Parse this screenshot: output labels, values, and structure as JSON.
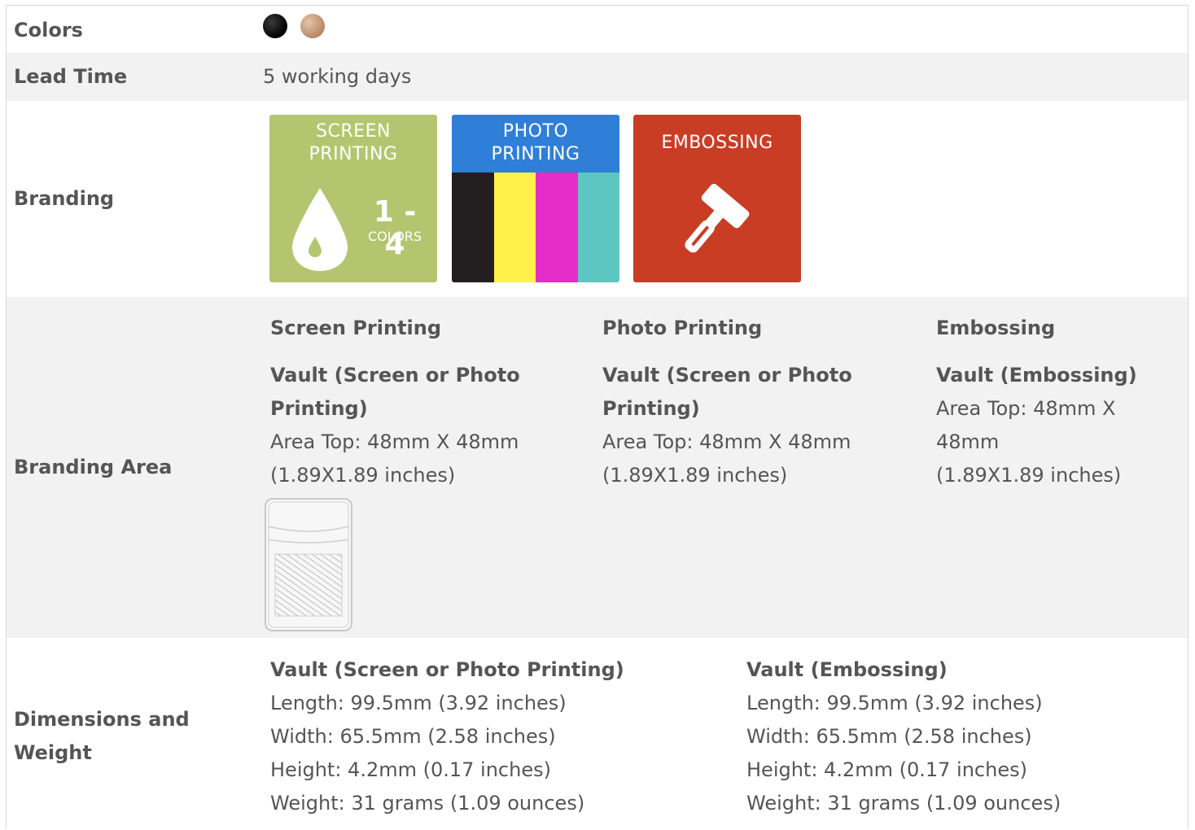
{
  "rows": {
    "colors": {
      "label": "Colors",
      "swatches": [
        "#111111",
        "#c9a07e"
      ]
    },
    "lead_time": {
      "label": "Lead Time",
      "value": "5 working days"
    },
    "branding": {
      "label": "Branding",
      "tiles": {
        "screen": {
          "title_line1": "SCREEN",
          "title_line2": "PRINTING",
          "count": "1 - 4",
          "count_unit": "COLORS",
          "color": "#b5c56f"
        },
        "photo": {
          "title_line1": "PHOTO",
          "title_line2": "PRINTING",
          "header_color": "#2f7fd8",
          "stripes": [
            "#231f20",
            "#fff04a",
            "#e52dc7",
            "#5ec6c0"
          ]
        },
        "emboss": {
          "title": "EMBOSSING",
          "color": "#c93d24"
        }
      }
    },
    "branding_area": {
      "label": "Branding Area",
      "columns": [
        {
          "heading": "Screen Printing",
          "sub1": "Vault (Screen or Photo",
          "sub2": "Printing)",
          "line1": "Area Top: 48mm X 48mm",
          "line2": "(1.89X1.89 inches)"
        },
        {
          "heading": "Photo Printing",
          "sub1": "Vault (Screen or Photo",
          "sub2": "Printing)",
          "line1": "Area Top: 48mm X 48mm",
          "line2": "(1.89X1.89 inches)"
        },
        {
          "heading": "Embossing",
          "sub1": "Vault (Embossing)",
          "line1": "Area Top: 48mm X",
          "line2": "48mm",
          "line3": "(1.89X1.89 inches)"
        }
      ]
    },
    "dimensions": {
      "label_line1": "Dimensions and",
      "label_line2": "Weight",
      "columns": [
        {
          "heading": "Vault (Screen or Photo Printing)",
          "length": "Length: 99.5mm (3.92 inches)",
          "width": "Width: 65.5mm (2.58 inches)",
          "height": "Height: 4.2mm (0.17 inches)",
          "weight": "Weight: 31 grams (1.09 ounces)"
        },
        {
          "heading": "Vault (Embossing)",
          "length": "Length: 99.5mm (3.92 inches)",
          "width": "Width: 65.5mm (2.58 inches)",
          "height": "Height: 4.2mm (0.17 inches)",
          "weight": "Weight: 31 grams (1.09 ounces)"
        }
      ]
    }
  }
}
